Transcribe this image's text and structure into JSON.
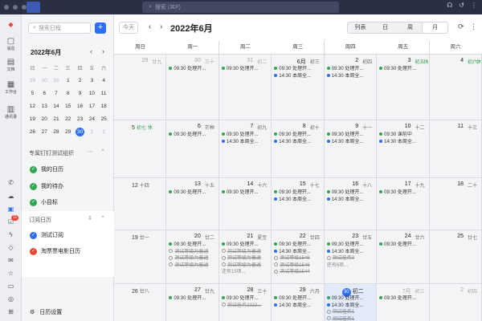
{
  "titlebar": {
    "search_placeholder": "搜索 (⌘F)"
  },
  "rail": {
    "items": [
      {
        "label": "消息",
        "icon": "message-icon"
      },
      {
        "label": "文档",
        "icon": "doc-icon"
      },
      {
        "label": "工作台",
        "icon": "apps-icon"
      },
      {
        "label": "通讯录",
        "icon": "contacts-icon"
      }
    ],
    "badge": "11"
  },
  "sidebar": {
    "search_placeholder": "搜索日程",
    "add": "+",
    "mini": {
      "title": "2022年6月",
      "weekdays": [
        "日",
        "一",
        "二",
        "三",
        "四",
        "五",
        "六"
      ],
      "rows": [
        [
          "29",
          "30",
          "31",
          "1",
          "2",
          "3",
          "4"
        ],
        [
          "5",
          "6",
          "7",
          "8",
          "9",
          "10",
          "11"
        ],
        [
          "12",
          "13",
          "14",
          "15",
          "16",
          "17",
          "18"
        ],
        [
          "19",
          "20",
          "21",
          "22",
          "23",
          "24",
          "25"
        ],
        [
          "26",
          "27",
          "28",
          "29",
          "30",
          "1",
          "2"
        ]
      ]
    },
    "org_section": "专属钉钉测试组织",
    "org_items": [
      "我的日历",
      "我的待办",
      "小目标"
    ],
    "sub_section": "订阅日历",
    "sub_items": [
      "测试订阅",
      "淘票票电影日历"
    ],
    "settings": "日历设置",
    "colors": {
      "green": "#2fa84f",
      "blue": "#2f6df6",
      "red": "#e8462f"
    }
  },
  "main": {
    "today": "今天",
    "prev": "‹",
    "next": "›",
    "title": "2022年6月",
    "views": [
      "列表",
      "日",
      "周",
      "月"
    ],
    "weekdays": [
      "周日",
      "周一",
      "周二",
      "周三",
      "周四",
      "周五",
      "周六"
    ],
    "weeks": [
      [
        {
          "d": "29",
          "l": "廿九",
          "o": true
        },
        {
          "d": "30",
          "l": "三十",
          "o": true,
          "ev": [
            "09:30 处理开..."
          ]
        },
        {
          "d": "31",
          "l": "初二",
          "o": true,
          "ev": [
            "09:30 处理开..."
          ]
        },
        {
          "d": "6月",
          "l": "初三",
          "ev": [
            "09:30 处理开...",
            "14:30 本周全..."
          ]
        },
        {
          "d": "2",
          "l": "初四",
          "ev": [
            "09:30 处理开...",
            "14:30 本周全..."
          ]
        },
        {
          "d": "3",
          "l": "初五",
          "off": "休",
          "ev": [
            "09:30 处理开..."
          ]
        },
        {
          "d": "4",
          "l": "初六",
          "off": "休"
        }
      ],
      [
        {
          "d": "5",
          "l": "初七",
          "off": "休",
          "left": true
        },
        {
          "d": "6",
          "l": "芒种",
          "ev": [
            "09:30 处理开..."
          ]
        },
        {
          "d": "7",
          "l": "初九",
          "ev": [
            "09:30 处理开...",
            "14:30 本周全..."
          ]
        },
        {
          "d": "8",
          "l": "初十",
          "ev": [
            "09:30 处理开...",
            "14:30 本周全..."
          ]
        },
        {
          "d": "9",
          "l": "十一",
          "ev": [
            "09:30 处理开...",
            "14:30 本周全..."
          ]
        },
        {
          "d": "10",
          "l": "十二",
          "ev": [
            "09:30 课前中",
            "14:30 本周全..."
          ]
        },
        {
          "d": "11",
          "l": "十三"
        }
      ],
      [
        {
          "d": "12",
          "l": "十四",
          "left": true
        },
        {
          "d": "13",
          "l": "十五",
          "ev": [
            "09:30 处理开..."
          ]
        },
        {
          "d": "14",
          "l": "十六",
          "ev": [
            "09:30 处理开..."
          ]
        },
        {
          "d": "15",
          "l": "十七",
          "ev": [
            "09:30 处理开...",
            "14:30 本周全..."
          ]
        },
        {
          "d": "16",
          "l": "十八",
          "ev": [
            "09:30 处理开...",
            "14:30 本周全..."
          ]
        },
        {
          "d": "17",
          "l": "十九",
          "ev": [
            "09:30 处理开..."
          ]
        },
        {
          "d": "18",
          "l": "二十"
        }
      ],
      [
        {
          "d": "19",
          "l": "廿一",
          "left": true
        },
        {
          "d": "20",
          "l": "廿二",
          "ev": [
            "09:30 处理开..."
          ],
          "tasks": [
            "测试等级为普通",
            "测试等级为普通",
            "测试等级为普通"
          ]
        },
        {
          "d": "21",
          "l": "夏至",
          "ev": [
            "09:30 处理开..."
          ],
          "tasks": [
            "测试等级为普通",
            "测试等级为普通",
            "测试等级为普通"
          ],
          "more": "还有15项..."
        },
        {
          "d": "22",
          "l": "廿四",
          "ev": [
            "09:30 处理开...",
            "14:30 本周全..."
          ],
          "tasks": [
            "测试等级1546",
            "测试等级1546",
            "测试等级1544"
          ]
        },
        {
          "d": "23",
          "l": "廿五",
          "ev": [
            "09:30 处理开...",
            "14:30 本周全..."
          ],
          "tasks": [
            "测试任务3"
          ],
          "more": "还有6项..."
        },
        {
          "d": "24",
          "l": "廿六",
          "ev": [
            "09:30 处理开..."
          ]
        },
        {
          "d": "25",
          "l": "廿七"
        }
      ],
      [
        {
          "d": "26",
          "l": "廿八",
          "left": true
        },
        {
          "d": "27",
          "l": "廿九",
          "ev": [
            "09:30 处理开..."
          ]
        },
        {
          "d": "28",
          "l": "三十",
          "ev": [
            "09:30 处理开..."
          ],
          "tasks": [
            "测试任务2222..."
          ]
        },
        {
          "d": "29",
          "l": "六月",
          "ev": [
            "09:30 处理开...",
            "14:30 本周全..."
          ]
        },
        {
          "d": "30",
          "l": "初二",
          "today": true,
          "ev": [
            "09:30 处理开...",
            "14:30 本周全..."
          ],
          "tasks": [
            "测试任务1",
            "测试任务1"
          ]
        },
        {
          "d": "7月",
          "l": "初三",
          "o": true,
          "ev": [
            "09:30 处理开..."
          ]
        },
        {
          "d": "2",
          "l": "初四",
          "o": true
        }
      ]
    ]
  }
}
